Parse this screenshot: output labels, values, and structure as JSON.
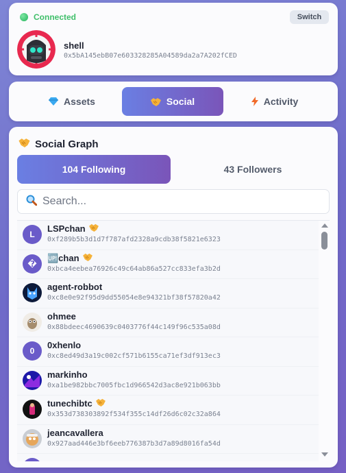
{
  "header": {
    "status": "Connected",
    "switch_label": "Switch",
    "username": "shell",
    "address": "0x5bA145ebB07e603328285A04589da2a7A202fCED"
  },
  "tabs": [
    {
      "label": "Assets",
      "icon": "diamond-icon"
    },
    {
      "label": "Social",
      "icon": "handshake-icon",
      "active": true
    },
    {
      "label": "Activity",
      "icon": "lightning-icon"
    }
  ],
  "social": {
    "title": "Social Graph",
    "following_label": "104 Following",
    "followers_label": "43 Followers",
    "search_placeholder": "Search..."
  },
  "following": [
    {
      "name": "LSPchan",
      "address": "0xf289b5b3d1d7f787afd2328a9cdb38f5821e6323",
      "mutual": true,
      "avatar": "L"
    },
    {
      "name": "🆙chan",
      "address": "0xbca4eebea76926c49c64ab86a527cc833efa3b2d",
      "mutual": true,
      "avatar": "�"
    },
    {
      "name": "agent-robbot",
      "address": "0xc8e0e92f95d9dd55054e8e94321bf38f57820a42",
      "mutual": false,
      "avatar": ""
    },
    {
      "name": "ohmee",
      "address": "0x88bdeec4690639c0403776f44c149f96c535a08d",
      "mutual": false,
      "avatar": ""
    },
    {
      "name": "0xhenlo",
      "address": "0xc8ed49d3a19c002cf571b6155ca71ef3df913ec3",
      "mutual": false,
      "avatar": "0"
    },
    {
      "name": "markinho",
      "address": "0xa1be982bbc7005fbc1d966542d3ac8e921b063bb",
      "mutual": false,
      "avatar": ""
    },
    {
      "name": "tunechibtc",
      "address": "0x353d738303892f534f355c14df26d6c02c32a864",
      "mutual": true,
      "avatar": ""
    },
    {
      "name": "jeancavallera",
      "address": "0x927aad446e3bf6eeb776387b3d7a89d8016fa54d",
      "mutual": false,
      "avatar": ""
    },
    {
      "name": "",
      "address": "",
      "mutual": false,
      "avatar": ""
    }
  ],
  "colors": {
    "accent_start": "#6a7fe3",
    "accent_end": "#7a55b9",
    "connected_green": "#3fbf6a"
  }
}
